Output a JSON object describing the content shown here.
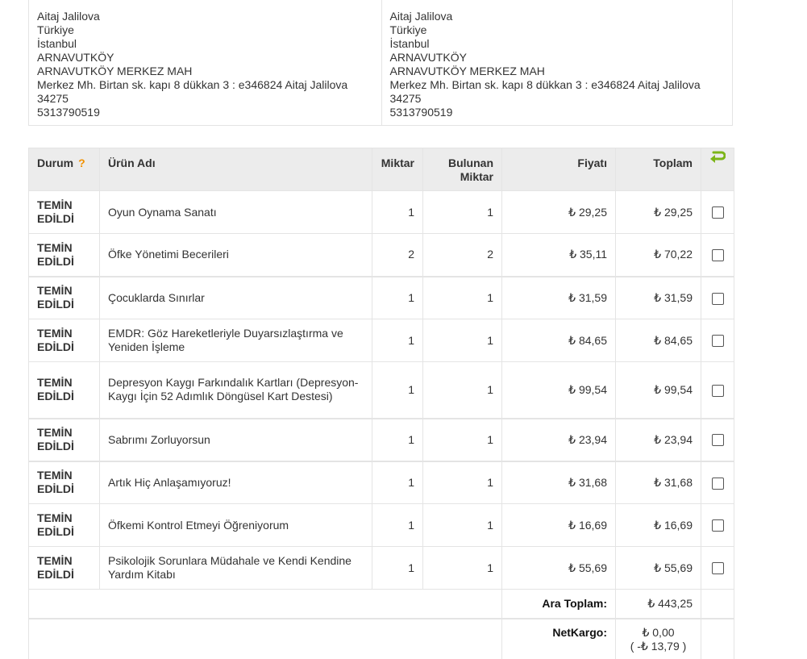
{
  "addresses": {
    "billing": {
      "name": "Aitaj Jalilova",
      "country": "Türkiye",
      "city": "İstanbul",
      "district": "ARNAVUTKÖY",
      "neighborhood": "ARNAVUTKÖY MERKEZ MAH",
      "street": "Merkez Mh. Birtan sk. kapı 8 dükkan 3 : e346824 Aitaj Jalilova",
      "postal": "34275",
      "phone": "5313790519"
    },
    "shipping": {
      "name": "Aitaj Jalilova",
      "country": "Türkiye",
      "city": "İstanbul",
      "district": "ARNAVUTKÖY",
      "neighborhood": "ARNAVUTKÖY MERKEZ MAH",
      "street": "Merkez Mh. Birtan sk. kapı 8 dükkan 3 : e346824 Aitaj Jalilova",
      "postal": "34275",
      "phone": "5313790519"
    }
  },
  "table": {
    "headers": {
      "durum": "Durum",
      "help": "?",
      "urun": "Ürün Adı",
      "miktar": "Miktar",
      "bulunan_1": "Bulunan",
      "bulunan_2": "Miktar",
      "fiyat": "Fiyatı",
      "toplam": "Toplam"
    },
    "status_line1": "TEMİN",
    "status_line2": "EDİLDİ",
    "currency": "₺",
    "rows": [
      {
        "name": "Oyun Oynama Sanatı",
        "qty": "1",
        "found": "1",
        "price": "₺ 29,25",
        "total": "₺ 29,25"
      },
      {
        "name": "Öfke Yönetimi Becerileri",
        "qty": "2",
        "found": "2",
        "price": "₺ 35,11",
        "total": "₺ 70,22"
      },
      {
        "name": "Çocuklarda Sınırlar",
        "qty": "1",
        "found": "1",
        "price": "₺ 31,59",
        "total": "₺ 31,59"
      },
      {
        "name": "EMDR: Göz Hareketleriyle Duyarsızlaştırma ve Yeniden İşleme",
        "qty": "1",
        "found": "1",
        "price": "₺ 84,65",
        "total": "₺ 84,65"
      },
      {
        "name": "Depresyon Kaygı Farkındalık Kartları (Depresyon-Kaygı İçin 52 Adımlık Döngüsel Kart Destesi)",
        "qty": "1",
        "found": "1",
        "price": "₺ 99,54",
        "total": "₺ 99,54"
      },
      {
        "name": "Sabrımı Zorluyorsun",
        "qty": "1",
        "found": "1",
        "price": "₺ 23,94",
        "total": "₺ 23,94"
      },
      {
        "name": "Artık Hiç Anlaşamıyoruz!",
        "qty": "1",
        "found": "1",
        "price": "₺ 31,68",
        "total": "₺ 31,68"
      },
      {
        "name": "Öfkemi Kontrol Etmeyi Öğreniyorum",
        "qty": "1",
        "found": "1",
        "price": "₺ 16,69",
        "total": "₺ 16,69"
      },
      {
        "name": "Psikolojik Sorunlara Müdahale ve Kendi Kendine Yardım Kitabı",
        "qty": "1",
        "found": "1",
        "price": "₺ 55,69",
        "total": "₺ 55,69"
      }
    ],
    "subtotal_label": "Ara Toplam:",
    "subtotal_value": "₺ 443,25",
    "shipping_label": "NetKargo:",
    "shipping_value": "₺ 0,00",
    "shipping_discount": "( -₺ 13,79 )"
  },
  "colors": {
    "header_bg": "#ececec",
    "border": "#e4e4e4",
    "help_orange": "#f29100",
    "undo_green": "#7cb518"
  },
  "icons": {
    "undo": "undo-arrow-icon",
    "checkbox": "checkbox-icon"
  }
}
